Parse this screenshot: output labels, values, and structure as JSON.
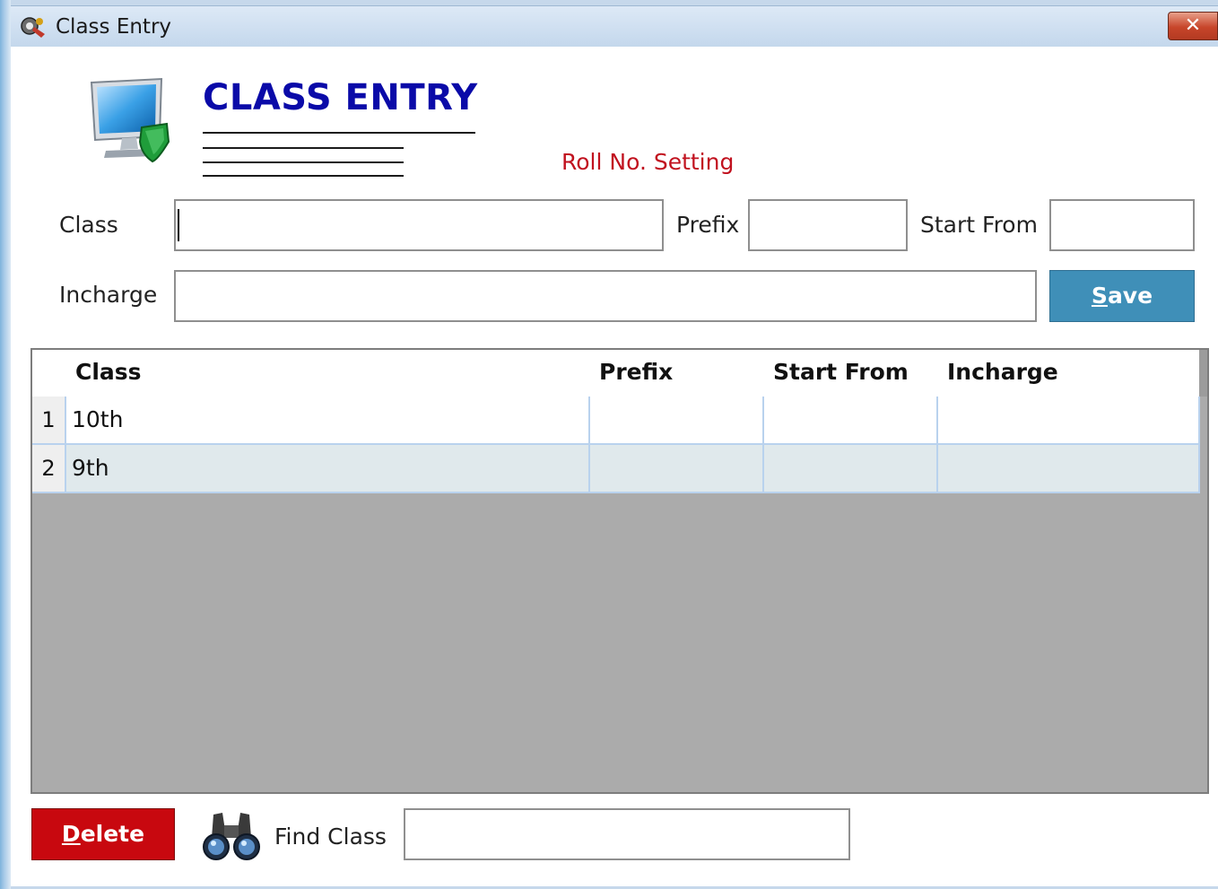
{
  "window": {
    "title": "Class Entry",
    "close_label": "✕"
  },
  "header": {
    "heading": "CLASS ENTRY",
    "roll_setting": "Roll No. Setting"
  },
  "form": {
    "class_label": "Class",
    "class_value": "",
    "prefix_label": "Prefix",
    "prefix_value": "",
    "start_from_label": "Start From",
    "start_from_value": "",
    "incharge_label": "Incharge",
    "incharge_value": "",
    "save_label": "Save",
    "save_accesskey": "S"
  },
  "grid": {
    "columns": [
      "Class",
      "Prefix",
      "Start From",
      "Incharge"
    ],
    "rows": [
      {
        "num": "1",
        "class": "10th",
        "prefix": "",
        "start_from": "",
        "incharge": ""
      },
      {
        "num": "2",
        "class": "9th",
        "prefix": "",
        "start_from": "",
        "incharge": ""
      }
    ]
  },
  "footer": {
    "delete_label": "Delete",
    "find_label": "Find Class",
    "find_value": ""
  },
  "colors": {
    "heading": "#0a0aa8",
    "roll_setting": "#c1121f",
    "save_button": "#3f8fb8",
    "delete_button": "#c8080f",
    "grid_background": "#ababab"
  },
  "icons": {
    "app": "app-logo-icon",
    "header": "monitor-shield-icon",
    "find": "binoculars-icon"
  }
}
